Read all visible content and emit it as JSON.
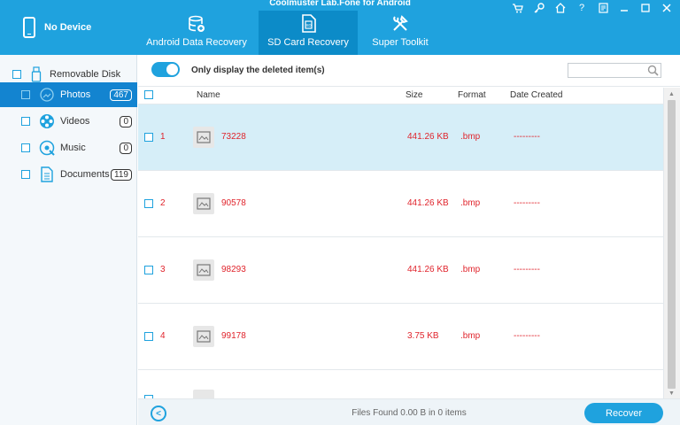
{
  "app": {
    "title": "Coolmuster Lab.Fone for Android"
  },
  "device": {
    "label": "No Device"
  },
  "tabs": [
    {
      "label": "Android Data Recovery",
      "icon": "database-icon",
      "active": false
    },
    {
      "label": "SD Card Recovery",
      "icon": "sd-card-icon",
      "active": true
    },
    {
      "label": "Super Toolkit",
      "icon": "tools-icon",
      "active": false
    }
  ],
  "window_controls": [
    "cart-icon",
    "key-icon",
    "home-icon",
    "help-icon",
    "feedback-icon",
    "minimize-icon",
    "maximize-icon",
    "close-icon"
  ],
  "sidebar": {
    "root": {
      "label": "Removable Disk",
      "icon": "usb-drive-icon"
    },
    "items": [
      {
        "label": "Photos",
        "count": "467",
        "icon": "photo-icon",
        "selected": true
      },
      {
        "label": "Videos",
        "count": "0",
        "icon": "film-reel-icon",
        "selected": false
      },
      {
        "label": "Music",
        "count": "0",
        "icon": "music-icon",
        "selected": false
      },
      {
        "label": "Documents",
        "count": "119",
        "icon": "document-icon",
        "selected": false
      }
    ]
  },
  "filter": {
    "label": "Only display the deleted item(s)",
    "toggle_on": true,
    "search_placeholder": ""
  },
  "table": {
    "headers": {
      "name": "Name",
      "size": "Size",
      "format": "Format",
      "date": "Date Created"
    },
    "rows": [
      {
        "num": "1",
        "name": "73228",
        "size": "441.26 KB",
        "format": ".bmp",
        "date": "---------",
        "selected": true
      },
      {
        "num": "2",
        "name": "90578",
        "size": "441.26 KB",
        "format": ".bmp",
        "date": "---------",
        "selected": false
      },
      {
        "num": "3",
        "name": "98293",
        "size": "441.26 KB",
        "format": ".bmp",
        "date": "---------",
        "selected": false
      },
      {
        "num": "4",
        "name": "99178",
        "size": "3.75 KB",
        "format": ".bmp",
        "date": "---------",
        "selected": false
      }
    ]
  },
  "footer": {
    "status": "Files Found 0.00 B in 0 items",
    "recover_label": "Recover"
  },
  "colors": {
    "accent": "#1fa2de",
    "selected_nav": "#1384d0",
    "row_selected": "#d6eef8",
    "deleted_text": "#e0242c"
  }
}
